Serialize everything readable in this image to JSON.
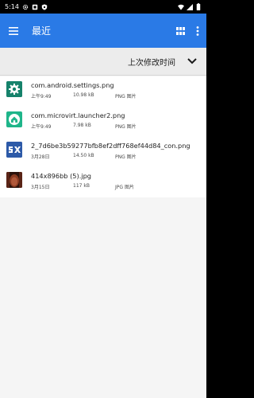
{
  "status_bar": {
    "time": "5:14",
    "icons_left": [
      "gear-icon",
      "sim-icon",
      "shield-icon"
    ],
    "icons_right": [
      "wifi-icon",
      "signal-icon",
      "battery-icon"
    ]
  },
  "app_bar": {
    "title": "最近",
    "accent": "#2a7ae6",
    "actions": [
      "grid-view-icon",
      "more-vert-icon"
    ]
  },
  "sort": {
    "label": "上次修改时间",
    "icon": "chevron-down-icon"
  },
  "files": [
    {
      "name": "com.android.settings.png",
      "date": "上午9:49",
      "size": "10.98 kB",
      "type": "PNG 图片",
      "thumb": "settings-app-icon"
    },
    {
      "name": "com.microvirt.launcher2.png",
      "date": "上午9:49",
      "size": "7.98 kB",
      "type": "PNG 图片",
      "thumb": "launcher-app-icon"
    },
    {
      "name": "2_7d6be3b59277bfb8ef2dff768ef44d84_con.png",
      "date": "3月28日",
      "size": "14.50 kB",
      "type": "PNG 图片",
      "thumb": "sx-logo-image"
    },
    {
      "name": "414x896bb (5).jpg",
      "date": "3月15日",
      "size": "117 kB",
      "type": "JPG 图片",
      "thumb": "photo-thumbnail"
    }
  ]
}
